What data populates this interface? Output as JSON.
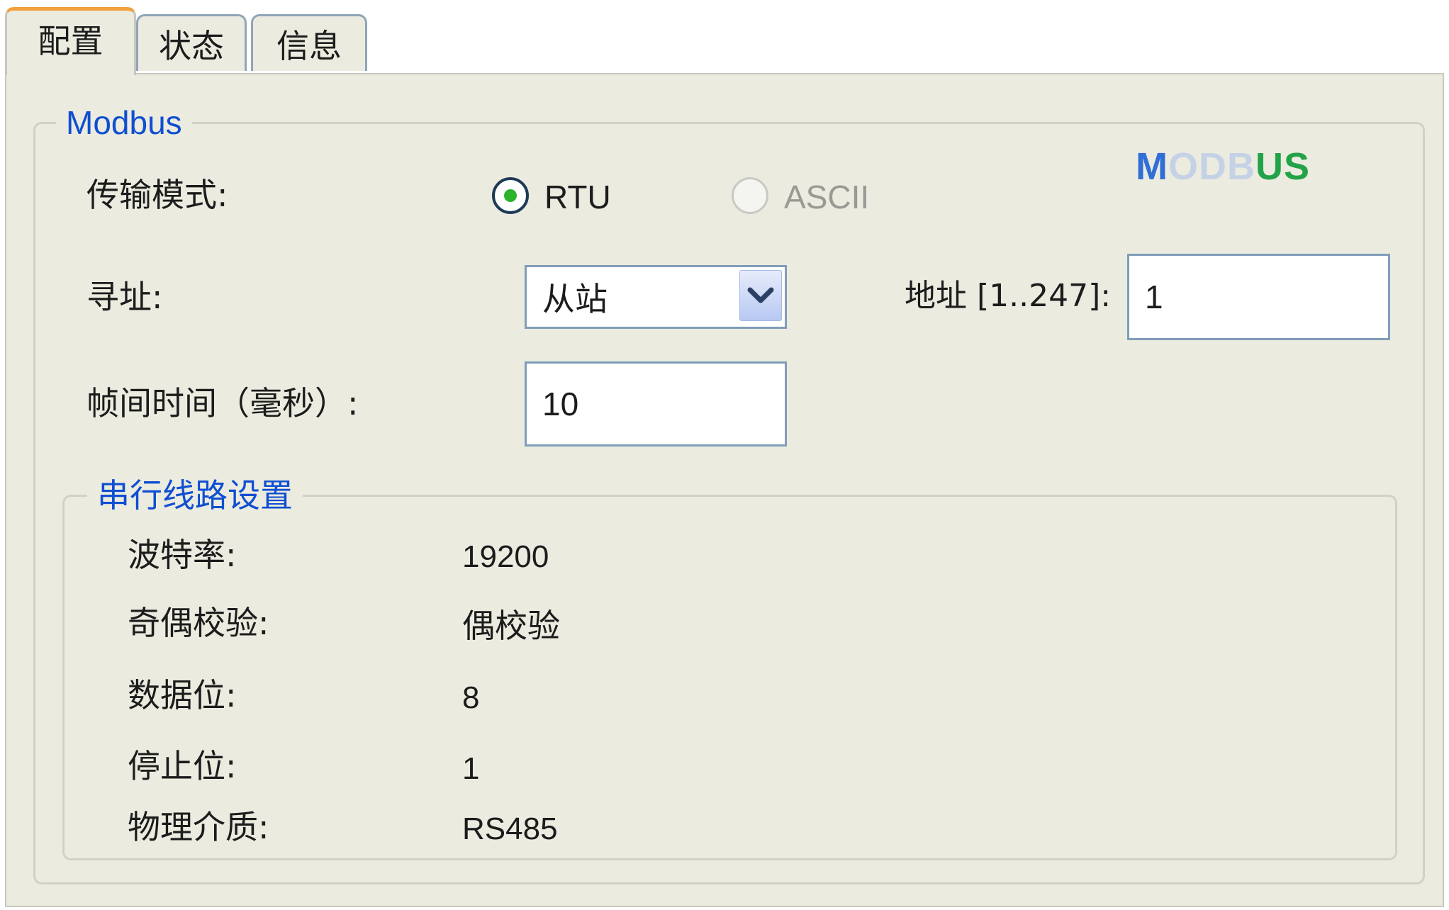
{
  "tabs": [
    {
      "label": "配置",
      "active": true
    },
    {
      "label": "状态",
      "active": false
    },
    {
      "label": "信息",
      "active": false
    }
  ],
  "modbus_group": {
    "legend": "Modbus",
    "logo": {
      "parts": [
        "M",
        "OD",
        "B",
        "US"
      ],
      "colors": [
        "#2f6fd6",
        "#c5d2e6",
        "#c5d2e6",
        "#22a348"
      ]
    },
    "transmission_mode": {
      "label": "传输模式:",
      "options": [
        {
          "label": "RTU",
          "selected": true,
          "enabled": true
        },
        {
          "label": "ASCII",
          "selected": false,
          "enabled": false
        }
      ]
    },
    "addressing": {
      "label": "寻址:",
      "selected": "从站",
      "icon": "chevron-down-icon"
    },
    "address": {
      "label": "地址 [1..247]:",
      "value": "1"
    },
    "frame_time": {
      "label": "帧间时间（毫秒）:",
      "value": "10"
    }
  },
  "serial_group": {
    "legend": "串行线路设置",
    "rows": [
      {
        "label": "波特率:",
        "value": "19200"
      },
      {
        "label": "奇偶校验:",
        "value": "偶校验"
      },
      {
        "label": "数据位:",
        "value": "8"
      },
      {
        "label": "停止位:",
        "value": "1"
      },
      {
        "label": "物理介质:",
        "value": "RS485"
      }
    ]
  },
  "colors": {
    "panel_bg": "#ecebe0",
    "legend_text": "#0f4fd1",
    "active_tab_accent": "#f0a13a",
    "field_border": "#7f9db9",
    "radio_dot": "#2bb32b"
  }
}
